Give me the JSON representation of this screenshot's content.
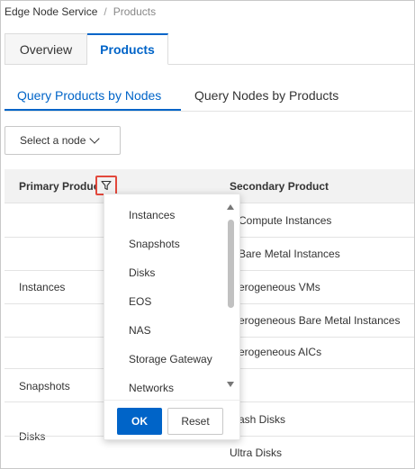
{
  "breadcrumb": {
    "root": "Edge Node Service",
    "separator": "/",
    "current": "Products"
  },
  "tabs": [
    {
      "label": "Overview",
      "active": false
    },
    {
      "label": "Products",
      "active": true
    }
  ],
  "subtabs": [
    {
      "label": "Query Products by Nodes",
      "active": true
    },
    {
      "label": "Query Nodes by Products",
      "active": false
    }
  ],
  "node_select": {
    "label": "Select a node"
  },
  "table": {
    "headers": {
      "primary": "Primary Product",
      "secondary": "Secondary Product"
    },
    "rows": [
      {
        "primary": "Instances",
        "secondary": [
          "6 Compute Instances",
          "6 Bare Metal Instances",
          "eterogeneous VMs",
          "eterogeneous Bare Metal Instances",
          "eterogeneous AICs"
        ]
      },
      {
        "primary": "Snapshots",
        "secondary": []
      },
      {
        "primary": "Disks",
        "secondary": [
          "-flash Disks",
          "Ultra Disks"
        ]
      }
    ]
  },
  "filter_dropdown": {
    "options": [
      "Instances",
      "Snapshots",
      "Disks",
      "EOS",
      "NAS",
      "Storage Gateway",
      "Networks"
    ],
    "ok_label": "OK",
    "reset_label": "Reset"
  },
  "colors": {
    "accent": "#0064c8",
    "filter_highlight": "#e2483c"
  }
}
